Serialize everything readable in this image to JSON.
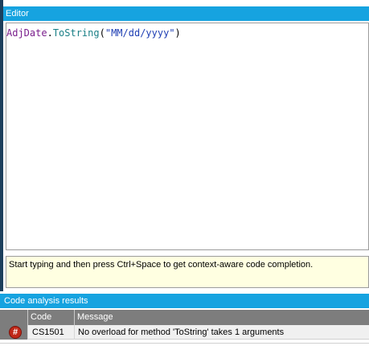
{
  "editor": {
    "title": "Editor",
    "code": {
      "ident": "AdjDate",
      "dot": ".",
      "method": "ToString",
      "open": "(",
      "string": "\"MM/dd/yyyy\"",
      "close": ")"
    },
    "hint": "Start typing and then press Ctrl+Space to get context-aware code completion."
  },
  "analysis": {
    "title": "Code analysis results",
    "columns": [
      "",
      "Code",
      "Message"
    ],
    "rows": [
      {
        "icon": "error-icon",
        "icon_glyph": "#",
        "code": "CS1501",
        "message": "No overload for method 'ToString' takes 1 arguments"
      }
    ]
  },
  "colors": {
    "header_blue": "#16a3e0",
    "grid_header_gray": "#7d7d7d",
    "hint_background": "#ffffe1",
    "error_red": "#c02818"
  }
}
